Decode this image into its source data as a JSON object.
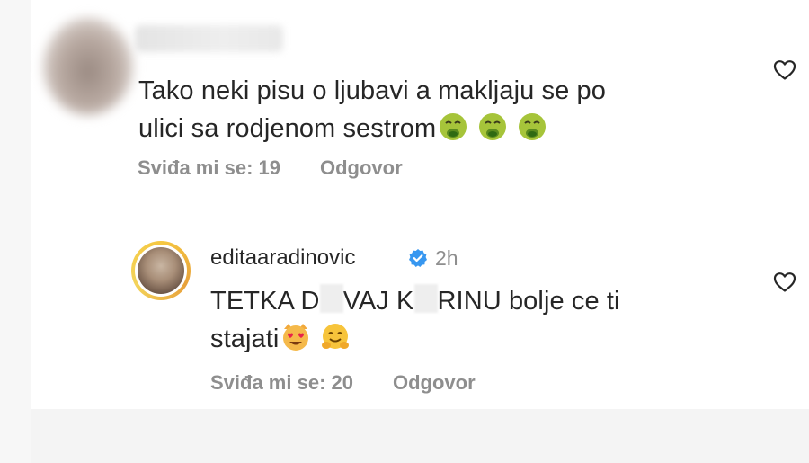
{
  "comment1": {
    "line1": "Tako neki pisu o ljubavi a makljaju se po",
    "line2": "ulici sa rodjenom sestrom",
    "emoji_icons": [
      "nauseated-face-icon",
      "nauseated-face-icon",
      "nauseated-face-icon"
    ],
    "likes": "Sviđa mi se: 19",
    "reply": "Odgovor"
  },
  "comment2": {
    "username": "editaaradinovic",
    "time": "2h",
    "text_part1": "TETKA D",
    "text_part2": "VAJ K",
    "text_part3": "RINU bolje ce ti",
    "line2": "stajati",
    "emoji_icons": [
      "smiling-cat-heart-eyes-icon",
      "hugging-face-icon"
    ],
    "likes": "Sviđa mi se: 20",
    "reply": "Odgovor"
  },
  "colors": {
    "text": "#262626",
    "meta": "#8e8e8e",
    "verified": "#3797f0"
  }
}
